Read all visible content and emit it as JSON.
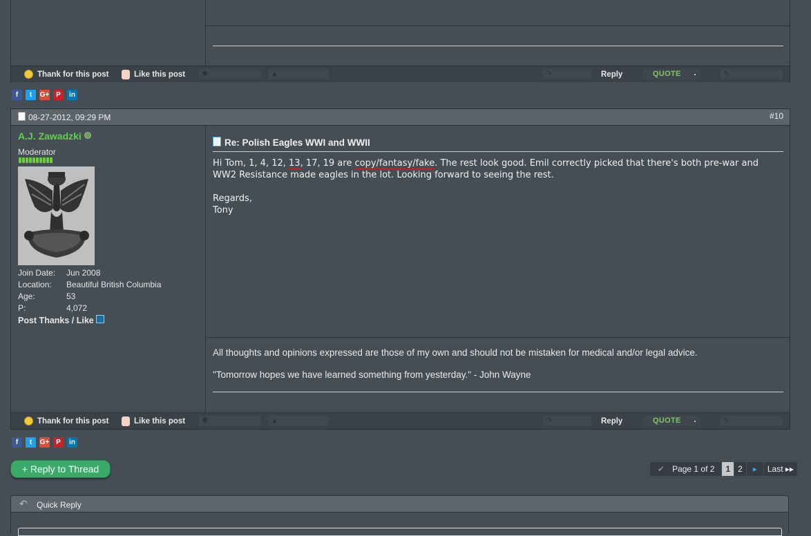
{
  "actions": {
    "thank": "Thank for this post",
    "like": "Like this post",
    "reply": "Reply",
    "quote": "QUOTE",
    "quote_dot": "."
  },
  "social": [
    "f",
    "t",
    "G+",
    "P",
    "in"
  ],
  "post": {
    "date": "08-27-2012, 09:29 PM",
    "number": "#10",
    "user": {
      "name": "A.J. Zawadzki",
      "title": "Moderator",
      "stats": [
        {
          "label": "Join Date:",
          "value": "Jun 2008"
        },
        {
          "label": "Location:",
          "value": "Beautiful British Columbia"
        },
        {
          "label": "Age:",
          "value": "53"
        },
        {
          "label": "P:",
          "value": "4,072"
        }
      ],
      "thanks_like": "Post Thanks / Like"
    },
    "title": "Re: Polish Eagles WWI and WWII",
    "body": {
      "p1a": "Hi Tom, 1, 4, 12, ",
      "p1b": "13",
      "p1c": ", 17, 19 are ",
      "p1d": "copy/fantasy/fake",
      "p1e": ". The rest look good. Emil correctly picked that there's both pre-war and WW2 Resistance made eagles in the lot. Looking forward to seeing the rest.",
      "p2": "Regards,",
      "p3": "Tony"
    },
    "signature": {
      "line1": "All thoughts and opinions expressed are those of my own and should not be mistaken for medical and/or legal advice.",
      "line2": "\"Tomorrow hopes we have learned something from yesterday.\" - John Wayne"
    }
  },
  "reply_to_thread": "+ Reply to Thread",
  "pager": {
    "label": "Page 1 of 2",
    "pages": [
      "1",
      "2"
    ],
    "next": "▸",
    "last": "Last ▸▸"
  },
  "quick_reply": "Quick Reply"
}
